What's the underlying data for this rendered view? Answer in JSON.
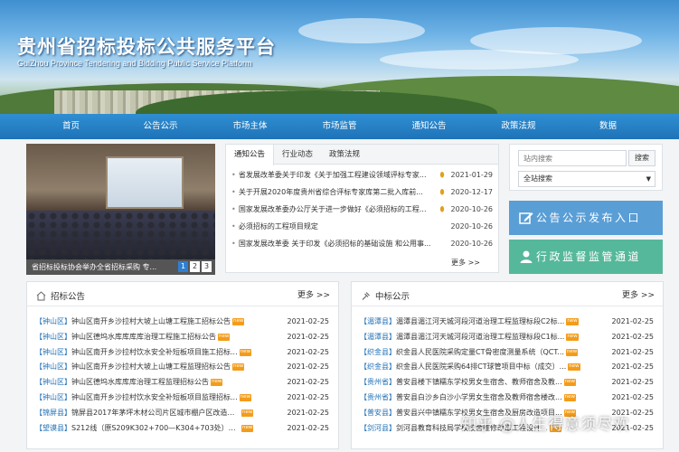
{
  "header": {
    "title": "贵州省招标投标公共服务平台",
    "subtitle": "GuiZhou Province Tendering and Bidding Public Service Platform"
  },
  "nav": [
    "首页",
    "公告公示",
    "市场主体",
    "市场监管",
    "通知公告",
    "政策法规",
    "数据"
  ],
  "slider": {
    "caption": "省招标投标协会举办全省招标采购 专...",
    "pages": [
      "1",
      "2",
      "3"
    ],
    "active_page": "1"
  },
  "notice": {
    "tabs": [
      "通知公告",
      "行业动态",
      "政策法规"
    ],
    "active_tab": "通知公告",
    "items": [
      {
        "title": "省发展改革委关于印发《关于加强工程建设领域评标专家...",
        "date": "2021-01-29",
        "flag": true
      },
      {
        "title": "关于开展2020年度贵州省综合评标专家库第二批入库前...",
        "date": "2020-12-17",
        "flag": true
      },
      {
        "title": "国家发展改革委办公厅关于进一步做好《必须招标的工程...",
        "date": "2020-10-26",
        "flag": true
      },
      {
        "title": "必须招标的工程项目规定",
        "date": "2020-10-26",
        "flag": false
      },
      {
        "title": "国家发展改革委 关于印发《必须招标的基础设施 和公用事...",
        "date": "2020-10-26",
        "flag": false
      }
    ],
    "more": "更多 >>"
  },
  "search": {
    "placeholder": "站内搜索",
    "button": "搜索",
    "scope": "全站搜索"
  },
  "entries": {
    "notice_entry": "公告公示发布入口",
    "supervision_entry": "行政监督监管通道"
  },
  "bid_notice": {
    "title": "招标公告",
    "more": "更多 >>",
    "items": [
      {
        "region": "【钟山区】",
        "title": "钟山区南开乡沙拉村大坡上山塘工程施工招标公告",
        "date": "2021-02-25"
      },
      {
        "region": "【钟山区】",
        "title": "钟山区德坞水库库库库治理工程施工招标公告",
        "date": "2021-02-25"
      },
      {
        "region": "【钟山区】",
        "title": "钟山区南开乡沙拉村饮水安全补短板项目施工招标...",
        "date": "2021-02-25"
      },
      {
        "region": "【钟山区】",
        "title": "钟山区南开乡沙拉村大坡上山塘工程监理招标公告",
        "date": "2021-02-25"
      },
      {
        "region": "【钟山区】",
        "title": "钟山区德坞水库库库治理工程监理招标公告",
        "date": "2021-02-25"
      },
      {
        "region": "【钟山区】",
        "title": "钟山区南开乡沙拉村饮水安全补短板项目监理招标...",
        "date": "2021-02-25"
      },
      {
        "region": "【锦屏县】",
        "title": "锦屏县2017年茅坪木材公司片区城市棚户区改造安...",
        "date": "2021-02-25"
      },
      {
        "region": "【望谟县】",
        "title": "S212线（原S209K302+700—K304+703处）灾毁...",
        "date": "2021-02-25"
      }
    ]
  },
  "bid_result": {
    "title": "中标公示",
    "more": "更多 >>",
    "items": [
      {
        "region": "【湄潭县】",
        "title": "湄潭县湄江河天城河段河道治理工程监理标段C2标...",
        "date": "2021-02-25"
      },
      {
        "region": "【湄潭县】",
        "title": "湄潭县湄江河天城河段河道治理工程监理标段C1标...",
        "date": "2021-02-25"
      },
      {
        "region": "【织金县】",
        "title": "织金县人民医院采购定量CT骨密度测量系统（QCT...",
        "date": "2021-02-25"
      },
      {
        "region": "【织金县】",
        "title": "织金县人民医院采购64排CT球管项目中标（成交）...",
        "date": "2021-02-25"
      },
      {
        "region": "【贵州省】",
        "title": "普安县楼下镇糯东学校男女生宿舍、教师宿舍及教...",
        "date": "2021-02-25"
      },
      {
        "region": "【贵州省】",
        "title": "普安县白沙乡白沙小学男女生宿舍及教师宿舍楼改...",
        "date": "2021-02-25"
      },
      {
        "region": "【普安县】",
        "title": "普安县兴中镇糯东学校男女生宿舍及厨房改造项目...",
        "date": "2021-02-25"
      },
      {
        "region": "【剑河县】",
        "title": "剑河县教育科技局学校校舍维修改造工程设计...",
        "date": "2021-02-25"
      }
    ]
  },
  "watermark": "知乎 @人生得意须尽欢"
}
